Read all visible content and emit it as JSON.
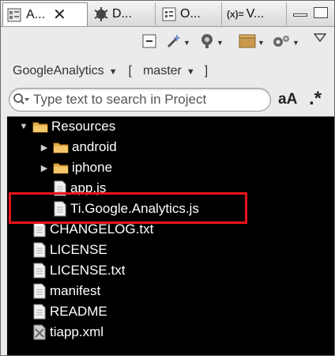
{
  "tabs": [
    {
      "label": "A...",
      "icon": "app-explorer-icon",
      "active": true,
      "close": "✕"
    },
    {
      "label": "D...",
      "icon": "debug-icon"
    },
    {
      "label": "O...",
      "icon": "outline-icon"
    },
    {
      "label": "V...",
      "icon": "variables-icon",
      "icon_text": "(x)="
    }
  ],
  "toolbar": {
    "icons": [
      "collapse-all-icon",
      "new-wizard-icon",
      "run-icon",
      "package-icon",
      "settings-gear-icon",
      "view-menu-icon"
    ],
    "dropdown_glyph": "▼"
  },
  "project": {
    "name": "GoogleAnalytics",
    "branch_open": "[",
    "branch": "master",
    "arrow": "▼"
  },
  "search": {
    "placeholder": "Type text to search in Project",
    "case_label": "aA",
    "regex_label": ".*"
  },
  "tree": {
    "items": [
      {
        "label": "Resources",
        "type": "folder",
        "expanded": true,
        "depth": 0,
        "caret": "▼"
      },
      {
        "label": "android",
        "type": "folder",
        "expanded": false,
        "depth": 1,
        "caret": "▶"
      },
      {
        "label": "iphone",
        "type": "folder",
        "expanded": false,
        "depth": 1,
        "caret": "▶"
      },
      {
        "label": "app.js",
        "type": "file",
        "depth": 1
      },
      {
        "label": "Ti.Google.Analytics.js",
        "type": "file",
        "depth": 1,
        "highlighted": true
      },
      {
        "label": "CHANGELOG.txt",
        "type": "file",
        "depth": 0
      },
      {
        "label": "LICENSE",
        "type": "file",
        "depth": 0
      },
      {
        "label": "LICENSE.txt",
        "type": "file",
        "depth": 0
      },
      {
        "label": "manifest",
        "type": "file",
        "depth": 0
      },
      {
        "label": "README",
        "type": "file",
        "depth": 0
      },
      {
        "label": "tiapp.xml",
        "type": "xml-file",
        "depth": 0
      }
    ]
  },
  "colors": {
    "tree_background": "#000000",
    "tree_text": "#ffffff",
    "highlight_border": "#e8141b",
    "folder": "#e8b04a"
  }
}
